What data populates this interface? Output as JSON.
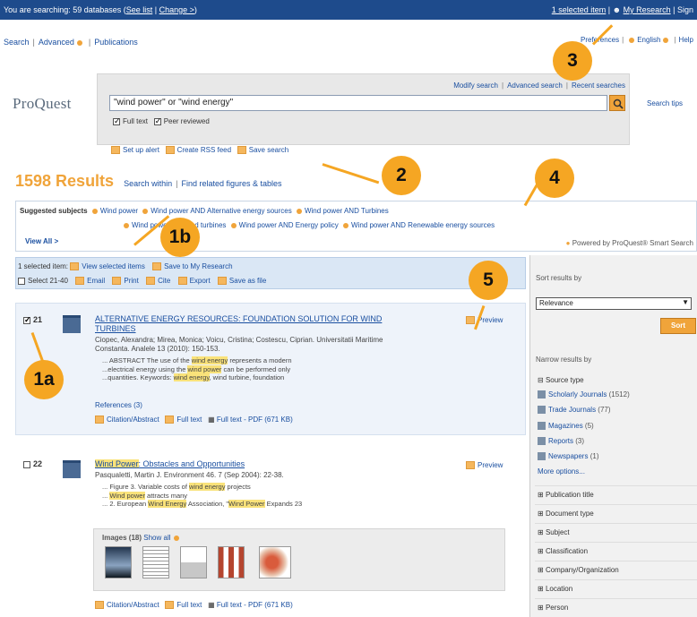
{
  "topbar": {
    "searching_prefix": "You are searching: 59 databases (",
    "see_list": "See list",
    "sep": " | ",
    "change": "Change >",
    "suffix": ")",
    "selected_item": "1 selected item",
    "my_research": "My Research",
    "sign": "Sign"
  },
  "nav_left": [
    "Search",
    "Advanced",
    "Publications"
  ],
  "nav_right": [
    "Preferences",
    "English",
    "Help"
  ],
  "logo": "ProQuest",
  "search": {
    "links": [
      "Modify search",
      "Advanced search",
      "Recent searches"
    ],
    "query": "\"wind power\" or \"wind energy\"",
    "tips": "Search tips",
    "checks": [
      {
        "label": "Full text",
        "checked": true
      },
      {
        "label": "Peer reviewed",
        "checked": true
      }
    ],
    "actions": [
      "Set up alert",
      "Create RSS feed",
      "Save search"
    ]
  },
  "results": {
    "count": "1598 Results",
    "links": [
      "Search within",
      "Find related figures & tables"
    ]
  },
  "suggested": {
    "label": "Suggested subjects",
    "row1": [
      "Wind power",
      "Wind power AND Alternative energy sources",
      "Wind power AND Turbines"
    ],
    "row2": [
      "Wind power",
      "Wind turbines",
      "Wind power AND Energy policy",
      "Wind power AND Renewable energy sources"
    ],
    "view_all": "View All >",
    "powered": "Powered by ProQuest® Smart Search"
  },
  "selection": {
    "count": "1 selected item:",
    "row1": [
      "View selected items",
      "Save to My Research"
    ],
    "select_range": "Select 21-40",
    "row2": [
      "Email",
      "Print",
      "Cite",
      "Export",
      "Save as file"
    ]
  },
  "result1": {
    "num": "21",
    "checked": true,
    "title_line1": "ALTERNATIVE ENERGY RESOURCES: FOUNDATION SOLUTION FOR WIND",
    "title_line2": "TURBINES",
    "meta_line1": "Ciopec, Alexandra; Mirea, Monica; Voicu, Cristina; Costescu, Ciprian. Universitatii Maritime",
    "meta_line2": "Constanta. Analele 13 (2010): 150-153.",
    "snip1a": "... ABSTRACT The use of the ",
    "snip1h": "wind energy",
    "snip1b": " represents a modern",
    "snip2a": "...electrical energy using the ",
    "snip2h": "wind power",
    "snip2b": " can be performed only",
    "snip3a": "...quantities. Keywords: ",
    "snip3h": "wind energy",
    "snip3b": ", wind turbine, foundation",
    "references": "References (3)",
    "links": [
      "Citation/Abstract",
      "Full text",
      "Full text - PDF (671 KB)"
    ],
    "preview": "Preview"
  },
  "result2": {
    "num": "22",
    "checked": false,
    "title_h": "Wind Power",
    "title_rest": ": Obstacles and Opportunities",
    "meta": "Pasqualetti, Martin J. Environment 46. 7  (Sep 2004): 22-38.",
    "snip1a": "... Figure 3. Variable costs of ",
    "snip1h": "wind energy",
    "snip1b": " projects",
    "snip2h": "Wind power",
    "snip2b": " attracts many",
    "snip3a": "... 2. European ",
    "snip3h1": "Wind Energy",
    "snip3m": " Association, \"",
    "snip3h2": "Wind Power",
    "snip3b": " Expands 23",
    "images_label": "Images (18)",
    "show_all": "Show all",
    "links": [
      "Citation/Abstract",
      "Full text",
      "Full text - PDF (671 KB)"
    ],
    "preview": "Preview"
  },
  "sidebar": {
    "sort_head": "Sort results by",
    "sort_value": "Relevance",
    "sort_btn": "Sort",
    "narrow_head": "Narrow results by",
    "source_type": "Source type",
    "sources": [
      {
        "name": "Scholarly Journals",
        "count": "(1512)"
      },
      {
        "name": "Trade Journals",
        "count": "(77)"
      },
      {
        "name": "Magazines",
        "count": "(5)"
      },
      {
        "name": "Reports",
        "count": "(3)"
      },
      {
        "name": "Newspapers",
        "count": "(1)"
      }
    ],
    "more": "More options...",
    "facets": [
      "Publication title",
      "Document type",
      "Subject",
      "Classification",
      "Company/Organization",
      "Location",
      "Person"
    ]
  },
  "callouts": [
    "1a",
    "1b",
    "2",
    "3",
    "4",
    "5"
  ],
  "colors": {
    "accent": "#f5a623",
    "topbar": "#1e4b8c",
    "link": "#1a4fa0",
    "highlight": "#f9e27a"
  }
}
